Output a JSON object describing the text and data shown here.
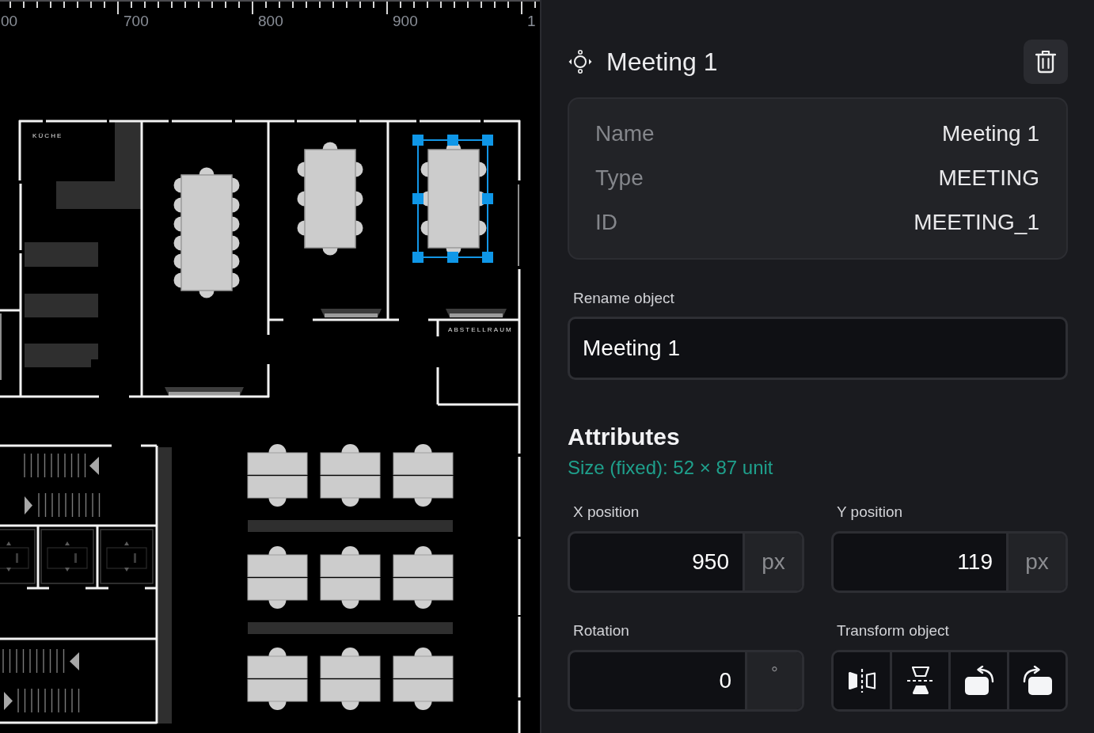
{
  "canvas": {
    "ruler_labels": [
      "00",
      "700",
      "800",
      "900",
      "1"
    ],
    "room_labels": [
      "KÜCHE",
      "ABSTELLRAUM"
    ],
    "meeting_tables": [
      {
        "kind": "long",
        "selected": false
      },
      {
        "kind": "short",
        "selected": false
      },
      {
        "kind": "short",
        "selected": true
      }
    ]
  },
  "panel": {
    "title": "Meeting 1",
    "details": [
      {
        "label": "Name",
        "value": "Meeting 1"
      },
      {
        "label": "Type",
        "value": "MEETING"
      },
      {
        "label": "ID",
        "value": "MEETING_1"
      }
    ],
    "rename": {
      "label": "Rename object",
      "value": "Meeting 1"
    },
    "attributes": {
      "heading": "Attributes",
      "size_note": "Size (fixed): 52 × 87 unit",
      "fields": [
        {
          "label": "X position",
          "value": "950",
          "unit": "px"
        },
        {
          "label": "Y position",
          "value": "119",
          "unit": "px"
        },
        {
          "label": "Rotation",
          "value": "0",
          "unit": "°"
        }
      ],
      "transform": {
        "label": "Transform object",
        "buttons": [
          {
            "kind": "flip-horizontal"
          },
          {
            "kind": "flip-vertical"
          },
          {
            "kind": "rotate-left"
          },
          {
            "kind": "rotate-right"
          }
        ]
      }
    }
  }
}
